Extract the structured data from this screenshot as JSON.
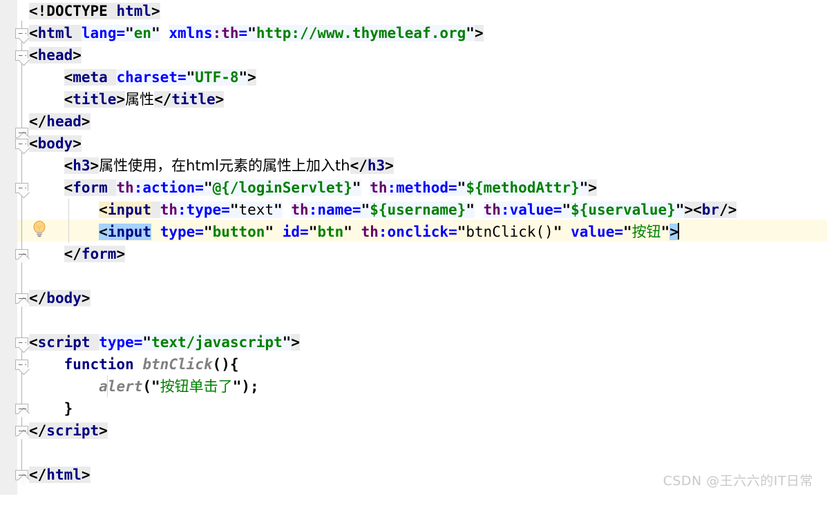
{
  "editor": {
    "language": "HTML (Thymeleaf)",
    "gutter_background": "#efefef",
    "current_line_background": "#fffae3",
    "selection_background": "#a6d2ff",
    "tag_color": "#000080",
    "attribute_color": "#0000ff",
    "namespace_color": "#660066",
    "value_color": "#008000",
    "function_color": "#808080"
  },
  "lines": [
    {
      "n": 1,
      "indent": 0,
      "text": "<!DOCTYPE html>"
    },
    {
      "n": 2,
      "indent": 0,
      "text": "<html lang=\"en\" xmlns:th=\"http://www.thymeleaf.org\">"
    },
    {
      "n": 3,
      "indent": 0,
      "text": "<head>"
    },
    {
      "n": 4,
      "indent": 1,
      "text": "<meta charset=\"UTF-8\">"
    },
    {
      "n": 5,
      "indent": 1,
      "text": "<title>属性</title>"
    },
    {
      "n": 6,
      "indent": 0,
      "text": "</head>"
    },
    {
      "n": 7,
      "indent": 0,
      "text": "<body>"
    },
    {
      "n": 8,
      "indent": 1,
      "text": "<h3>属性使用，在html元素的属性上加入th</h3>"
    },
    {
      "n": 9,
      "indent": 1,
      "text": "<form th:action=\"@{/loginServlet}\" th:method=\"${methodAttr}\">"
    },
    {
      "n": 10,
      "indent": 2,
      "text": "<input th:type=\"text\" th:name=\"${username}\" th:value=\"${uservalue}\"><br/>"
    },
    {
      "n": 11,
      "indent": 2,
      "text": "<input type=\"button\" id=\"btn\" th:onclick=\"btnClick()\" value=\"按钮\">"
    },
    {
      "n": 12,
      "indent": 1,
      "text": "</form>"
    },
    {
      "n": 13,
      "indent": 0,
      "text": ""
    },
    {
      "n": 14,
      "indent": 0,
      "text": "</body>"
    },
    {
      "n": 15,
      "indent": 0,
      "text": ""
    },
    {
      "n": 16,
      "indent": 0,
      "text": ""
    },
    {
      "n": 17,
      "indent": 0,
      "text": "<script type=\"text/javascript\">"
    },
    {
      "n": 18,
      "indent": 1,
      "text": "function btnClick(){"
    },
    {
      "n": 19,
      "indent": 2,
      "text": "alert(\"按钮单击了\");"
    },
    {
      "n": 20,
      "indent": 1,
      "text": "}"
    },
    {
      "n": 21,
      "indent": 0,
      "text": "</scr"
    },
    {
      "n": 22,
      "indent": 0,
      "text": ""
    },
    {
      "n": 23,
      "indent": 0,
      "text": ""
    },
    {
      "n": 24,
      "indent": 0,
      "text": "</html>"
    }
  ],
  "tokens": {
    "doctype": "<!DOCTYPE",
    "html_word": "html",
    "gt": ">",
    "lt": "<",
    "lt_slash": "</",
    "tag_html": "html",
    "attr_lang": "lang",
    "eq": "=",
    "q": "\"",
    "val_en": "en",
    "attr_xmlns": "xmlns",
    "ns_th": ":th",
    "val_thymeleaf_url": "http://www.thymeleaf.org",
    "tag_head": "head",
    "tag_meta": "meta",
    "attr_charset": "charset",
    "val_utf8": "UTF-8",
    "tag_title": "title",
    "title_text": "属性",
    "tag_body": "body",
    "tag_h3": "h3",
    "h3_text": "属性使用，在html元素的属性上加入th",
    "tag_form": "form",
    "th_prefix": "th",
    "colon_action": ":action",
    "val_action": "@{/loginServlet}",
    "colon_method": ":method",
    "val_method": "${methodAttr}",
    "tag_input": "<input",
    "colon_type": ":type",
    "val_text": "text",
    "colon_name": ":name",
    "val_username": "${username}",
    "colon_value": ":value",
    "val_uservalue": "${uservalue}",
    "br_tag": "<br/>",
    "attr_type": "type",
    "val_button": "button",
    "attr_id": "id",
    "val_btn": "btn",
    "colon_onclick": ":onclick",
    "val_btnclick": "btnClick()",
    "attr_value": "value",
    "val_anniu": "按钮",
    "tag_script": "script",
    "attr_script_type": "type",
    "val_textjs": "text/javascript",
    "kw_function": "function",
    "fn_btnclick": "btnClick",
    "parens_open_brace": "(){",
    "fn_alert": "alert",
    "paren_open": "(",
    "str_alert": "按钮单击了",
    "paren_close_semi": ");",
    "brace_close": "}"
  },
  "gutter": {
    "bulb_icon": "lightbulb-intention-icon",
    "fold_icon": "fold-collapse-icon"
  },
  "watermark": {
    "text": "CSDN @王六六的IT日常"
  }
}
